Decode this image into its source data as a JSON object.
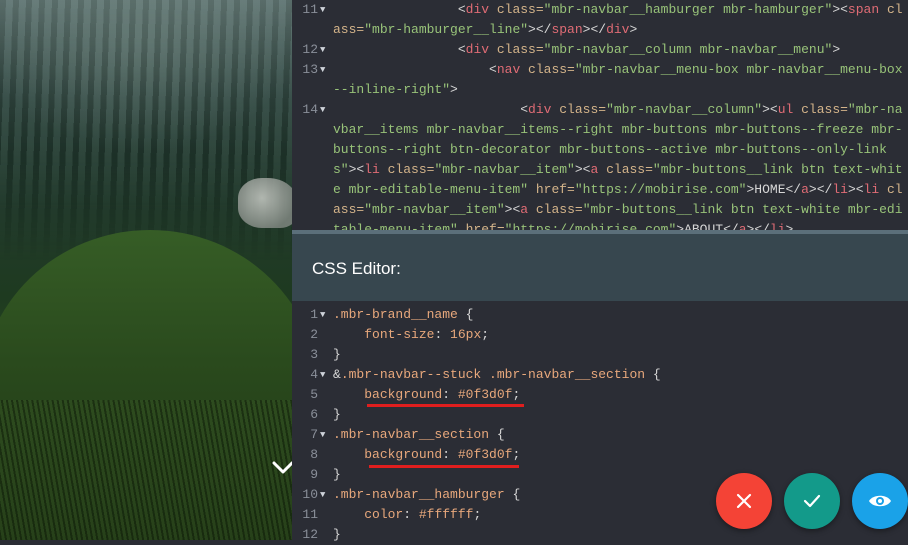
{
  "html_editor": {
    "lines": [
      {
        "num": "11",
        "fold": true,
        "parts": [
          {
            "c": "p",
            "t": "                <"
          },
          {
            "c": "t",
            "t": "div"
          },
          {
            "c": "a",
            "t": " class="
          },
          {
            "c": "s",
            "t": "\"mbr-navbar__hamburger mbr-hamburger\""
          },
          {
            "c": "p",
            "t": "><"
          },
          {
            "c": "t",
            "t": "span"
          },
          {
            "c": "a",
            "t": " class="
          },
          {
            "c": "s",
            "t": "\"mbr-hamburger__line\""
          },
          {
            "c": "p",
            "t": "></"
          },
          {
            "c": "t",
            "t": "span"
          },
          {
            "c": "p",
            "t": "></"
          },
          {
            "c": "t",
            "t": "div"
          },
          {
            "c": "p",
            "t": ">"
          }
        ]
      },
      {
        "num": "12",
        "fold": true,
        "parts": [
          {
            "c": "p",
            "t": "                <"
          },
          {
            "c": "t",
            "t": "div"
          },
          {
            "c": "a",
            "t": " class="
          },
          {
            "c": "s",
            "t": "\"mbr-navbar__column mbr-navbar__menu\""
          },
          {
            "c": "p",
            "t": ">"
          }
        ]
      },
      {
        "num": "13",
        "fold": true,
        "parts": [
          {
            "c": "p",
            "t": "                    <"
          },
          {
            "c": "t",
            "t": "nav"
          },
          {
            "c": "a",
            "t": " class="
          },
          {
            "c": "s",
            "t": "\"mbr-navbar__menu-box mbr-navbar__menu-box--inline-right\""
          },
          {
            "c": "p",
            "t": ">"
          }
        ]
      },
      {
        "num": "14",
        "fold": true,
        "parts": [
          {
            "c": "p",
            "t": "                        <"
          },
          {
            "c": "t",
            "t": "div"
          },
          {
            "c": "a",
            "t": " class="
          },
          {
            "c": "s",
            "t": "\"mbr-navbar__column\""
          },
          {
            "c": "p",
            "t": "><"
          },
          {
            "c": "t",
            "t": "ul"
          },
          {
            "c": "a",
            "t": " class="
          },
          {
            "c": "s",
            "t": "\"mbr-navbar__items mbr-navbar__items--right mbr-buttons mbr-buttons--freeze mbr-buttons--right btn-decorator mbr-buttons--active mbr-buttons--only-links\""
          },
          {
            "c": "p",
            "t": "><"
          },
          {
            "c": "t",
            "t": "li"
          },
          {
            "c": "a",
            "t": " class="
          },
          {
            "c": "s",
            "t": "\"mbr-navbar__item\""
          },
          {
            "c": "p",
            "t": "><"
          },
          {
            "c": "t",
            "t": "a"
          },
          {
            "c": "a",
            "t": " class="
          },
          {
            "c": "s",
            "t": "\"mbr-buttons__link btn text-white mbr-editable-menu-item\""
          },
          {
            "c": "a",
            "t": " href="
          },
          {
            "c": "s",
            "t": "\"https://mobirise.com\""
          },
          {
            "c": "p",
            "t": ">HOME</"
          },
          {
            "c": "t",
            "t": "a"
          },
          {
            "c": "p",
            "t": "></"
          },
          {
            "c": "t",
            "t": "li"
          },
          {
            "c": "p",
            "t": "><"
          },
          {
            "c": "t",
            "t": "li"
          },
          {
            "c": "a",
            "t": " class="
          },
          {
            "c": "s",
            "t": "\"mbr-navbar__item\""
          },
          {
            "c": "p",
            "t": "><"
          },
          {
            "c": "t",
            "t": "a"
          },
          {
            "c": "a",
            "t": " class="
          },
          {
            "c": "s",
            "t": "\"mbr-buttons__link btn text-white mbr-editable-menu-item\""
          },
          {
            "c": "a",
            "t": " href="
          },
          {
            "c": "s",
            "t": "\"https://mobirise.com\""
          },
          {
            "c": "p",
            "t": ">ABOUT</"
          },
          {
            "c": "t",
            "t": "a"
          },
          {
            "c": "p",
            "t": "></"
          },
          {
            "c": "t",
            "t": "li"
          },
          {
            "c": "p",
            "t": ">"
          }
        ]
      }
    ]
  },
  "css_editor": {
    "title": "CSS Editor:",
    "lines": [
      {
        "num": "1",
        "fold": true,
        "parts": [
          {
            "c": "sel",
            "t": ".mbr-brand__name "
          },
          {
            "c": "br",
            "t": "{"
          }
        ]
      },
      {
        "num": "2",
        "fold": false,
        "parts": [
          {
            "c": "prop",
            "t": "    font-size"
          },
          {
            "c": "br",
            "t": ": "
          },
          {
            "c": "val",
            "t": "16px"
          },
          {
            "c": "br",
            "t": ";"
          }
        ]
      },
      {
        "num": "3",
        "fold": false,
        "parts": [
          {
            "c": "br",
            "t": "}"
          }
        ]
      },
      {
        "num": "4",
        "fold": true,
        "parts": [
          {
            "c": "br",
            "t": "&"
          },
          {
            "c": "sel",
            "t": ".mbr-navbar--stuck .mbr-navbar__section "
          },
          {
            "c": "br",
            "t": "{"
          }
        ]
      },
      {
        "num": "5",
        "fold": false,
        "parts": [
          {
            "c": "prop",
            "t": "    background"
          },
          {
            "c": "br",
            "t": ": "
          },
          {
            "c": "val",
            "t": "#0f3d0f"
          },
          {
            "c": "br",
            "t": ";"
          }
        ]
      },
      {
        "num": "6",
        "fold": false,
        "parts": [
          {
            "c": "br",
            "t": "}"
          }
        ]
      },
      {
        "num": "7",
        "fold": true,
        "parts": [
          {
            "c": "sel",
            "t": ".mbr-navbar__section "
          },
          {
            "c": "br",
            "t": "{"
          }
        ]
      },
      {
        "num": "8",
        "fold": false,
        "parts": [
          {
            "c": "prop",
            "t": "    background"
          },
          {
            "c": "br",
            "t": ": "
          },
          {
            "c": "val",
            "t": "#0f3d0f"
          },
          {
            "c": "br",
            "t": ";"
          }
        ]
      },
      {
        "num": "9",
        "fold": false,
        "parts": [
          {
            "c": "br",
            "t": "}"
          }
        ]
      },
      {
        "num": "10",
        "fold": true,
        "parts": [
          {
            "c": "sel",
            "t": ".mbr-navbar__hamburger "
          },
          {
            "c": "br",
            "t": "{"
          }
        ]
      },
      {
        "num": "11",
        "fold": false,
        "parts": [
          {
            "c": "prop",
            "t": "    color"
          },
          {
            "c": "br",
            "t": ": "
          },
          {
            "c": "val",
            "t": "#ffffff"
          },
          {
            "c": "br",
            "t": ";"
          }
        ]
      },
      {
        "num": "12",
        "fold": false,
        "parts": [
          {
            "c": "br",
            "t": "}"
          }
        ]
      }
    ]
  },
  "icons": {
    "scroll_down": "chevron-down-icon",
    "close": "close-icon",
    "confirm": "check-icon",
    "preview": "eye-icon"
  },
  "colors": {
    "close_button": "#f44336",
    "confirm_button": "#139a8a",
    "preview_button": "#1aa2e8",
    "highlight_underline": "#e01e1e",
    "css_header": "#37474f"
  }
}
